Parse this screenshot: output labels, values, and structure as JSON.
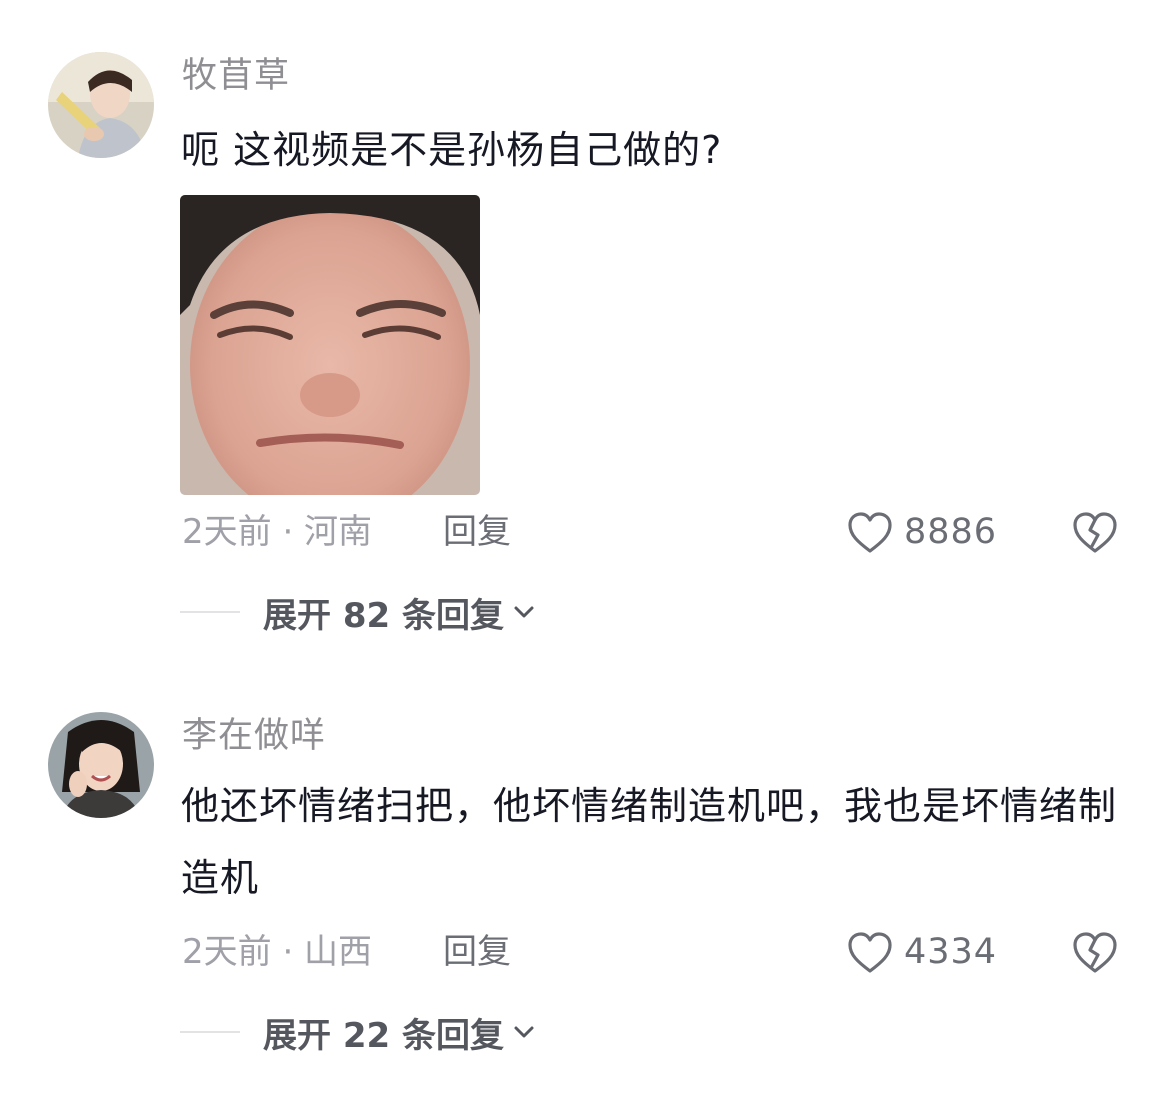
{
  "comments": [
    {
      "username": "牧苜草",
      "text": "呃 这视频是不是孙杨自己做的?",
      "has_sticker": true,
      "meta": "2天前 · 河南",
      "reply_label": "回复",
      "likes": "8886",
      "expand_label": "展开 82 条回复"
    },
    {
      "username": "李在做咩",
      "text": "他还坏情绪扫把，他坏情绪制造机吧，我也是坏情绪制造机",
      "has_sticker": false,
      "meta": "2天前 · 山西",
      "reply_label": "回复",
      "likes": "4334",
      "expand_label": "展开 22 条回复"
    }
  ],
  "icons": {
    "like": "heart-outline-icon",
    "dislike": "broken-heart-icon",
    "expand": "chevron-down-icon"
  }
}
